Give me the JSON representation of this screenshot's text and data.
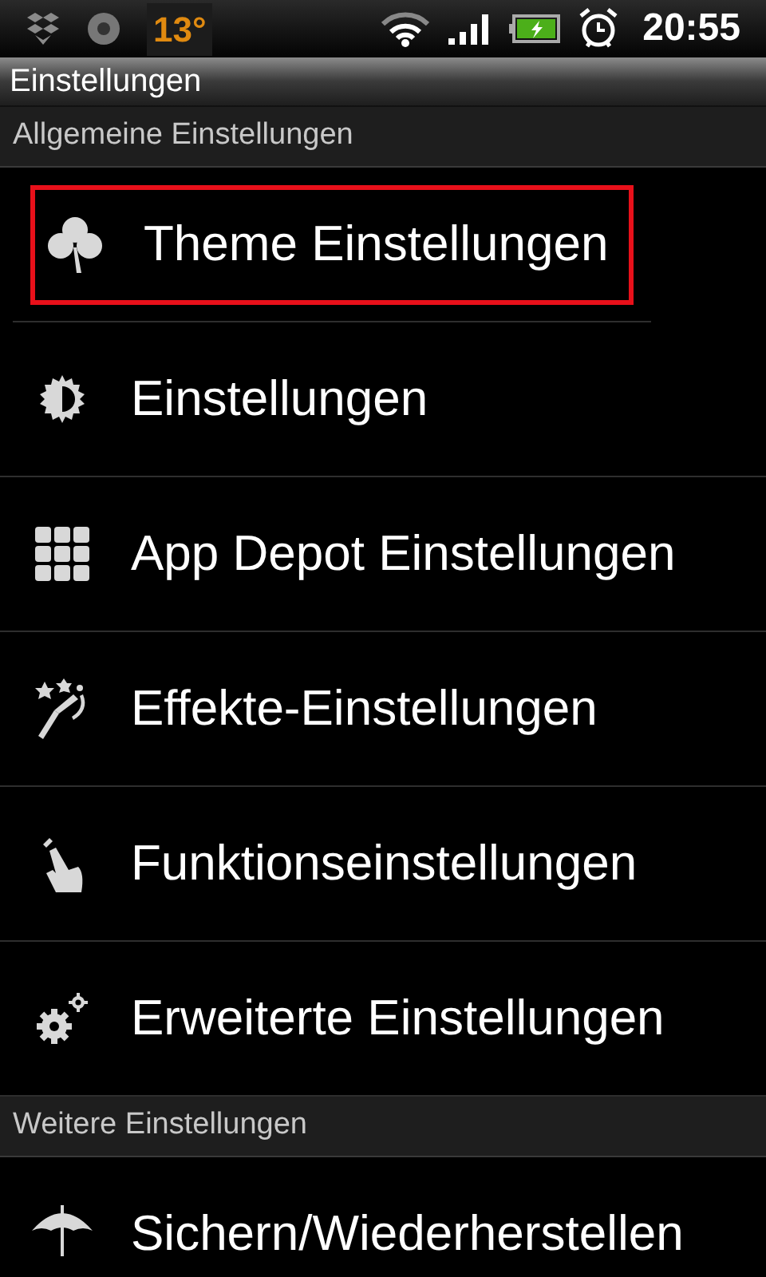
{
  "status_bar": {
    "temperature": "13°",
    "time": "20:55"
  },
  "title_bar": {
    "title": "Einstellungen"
  },
  "sections": [
    {
      "header": "Allgemeine Einstellungen",
      "items": [
        {
          "label": "Theme Einstellungen",
          "highlighted": true
        },
        {
          "label": "Einstellungen",
          "highlighted": false
        },
        {
          "label": "App Depot Einstellungen",
          "highlighted": false
        },
        {
          "label": "Effekte-Einstellungen",
          "highlighted": false
        },
        {
          "label": "Funktionseinstellungen",
          "highlighted": false
        },
        {
          "label": "Erweiterte Einstellungen",
          "highlighted": false
        }
      ]
    },
    {
      "header": "Weitere Einstellungen",
      "items": [
        {
          "label": "Sichern/Wiederherstellen",
          "highlighted": false
        }
      ]
    }
  ]
}
